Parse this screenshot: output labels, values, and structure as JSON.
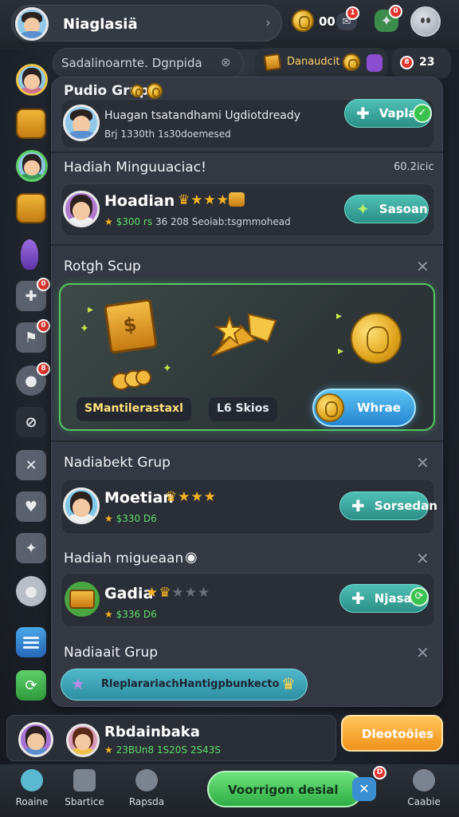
{
  "header": {
    "profile_name": "Niaglasiä",
    "coins_value": "00",
    "mail_badge": "1",
    "gift_badge": "0"
  },
  "subheader": {
    "search_text": "Sadalinoarnte. Dgnpida",
    "promo_label": "Danaudcit",
    "counter_label": "23",
    "counter_badge": "8"
  },
  "sidebar": {
    "items": [
      {
        "icon": "avatar-icon"
      },
      {
        "icon": "mail-icon"
      },
      {
        "icon": "avatar-icon"
      },
      {
        "icon": "chest-icon"
      },
      {
        "icon": "eggplant-icon"
      },
      {
        "icon": "plus-icon",
        "badge": "0"
      },
      {
        "icon": "flag-icon",
        "badge": "0"
      },
      {
        "icon": "mouse-icon",
        "badge": "8"
      },
      {
        "icon": "clover-icon"
      },
      {
        "icon": "swords-icon"
      },
      {
        "icon": "heart-icon"
      },
      {
        "icon": "fox-icon"
      },
      {
        "icon": "bear-icon"
      },
      {
        "icon": "list-icon"
      },
      {
        "icon": "refresh-icon"
      }
    ]
  },
  "section1": {
    "title": "Pudio Grup",
    "row": {
      "title": "Huagan tsatandhami Ugdiotdready",
      "subtitle": "Brj 1330th 1s30doemesed",
      "button": "Vapla"
    }
  },
  "section2": {
    "title": "Hadiah Minguuaciac!",
    "right_note": "60.2icic",
    "row": {
      "name": "Hoadian",
      "stars": 3,
      "sub_green": "$300 rs",
      "sub_rest": " 36 208 Seoiab:tsgmmohead",
      "button": "Sasoan"
    }
  },
  "section3": {
    "title": "Rotgh Scup",
    "label1": "SMantilerastaxl",
    "label2": "L6 Skios",
    "claim_button": "Whrae"
  },
  "section4": {
    "title": "Nadiabekt Grup",
    "row": {
      "name": "Moetian",
      "stars": 3,
      "sub": "$330 D6",
      "button": "Sorsedan"
    }
  },
  "section5": {
    "title": "Hadiah migueaan",
    "row": {
      "name": "Gadia",
      "stars": 1,
      "sub": "$336 D6",
      "button": "Njasa"
    }
  },
  "section6": {
    "title": "Nadiaait Grup",
    "button": "RleplarariachHantigpbunkecto"
  },
  "lower_row": {
    "name": "Rbdainbaka",
    "sub": "23BUn8 1S20S 2S43S",
    "button": "Dleotoöies"
  },
  "bottom_nav": {
    "items": [
      "Roaine",
      "Sbartice",
      "Rapsda",
      "Caabie"
    ],
    "center_button": "Voorrigon desial",
    "center_badge": "D"
  },
  "colors": {
    "accent_teal": "#3aa89e",
    "accent_green": "#39c24e",
    "accent_orange": "#f5a623",
    "accent_blue": "#3aa3e6",
    "panel_bg": "#333842"
  }
}
